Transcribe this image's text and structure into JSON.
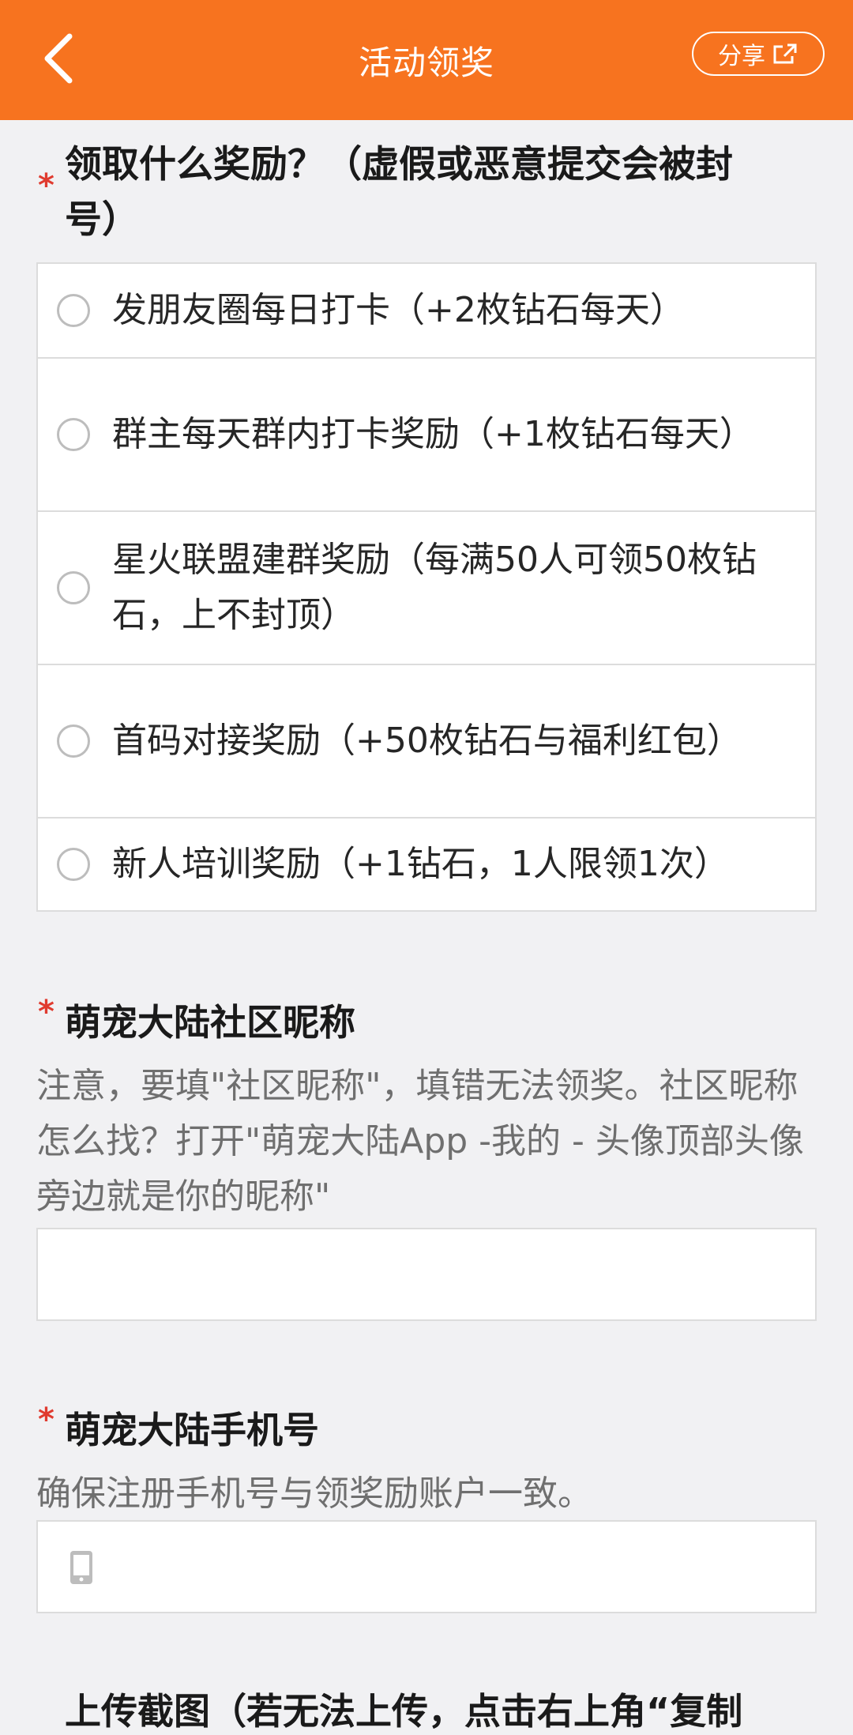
{
  "header": {
    "title": "活动领奖",
    "share_label": "分享",
    "bg_color": "#f7731f",
    "icons": {
      "back": "chevron-left-icon",
      "share": "external-share-icon"
    }
  },
  "question_reward": {
    "required_mark": "*",
    "title": "领取什么奖励？（虚假或恶意提交会被封号）",
    "options": [
      {
        "label": "发朋友圈每日打卡（+2枚钻石每天）"
      },
      {
        "label": "群主每天群内打卡奖励（+1枚钻石每天）"
      },
      {
        "label": "星火联盟建群奖励（每满50人可领50枚钻石，上不封顶）"
      },
      {
        "label": "首码对接奖励（+50枚钻石与福利红包）"
      },
      {
        "label": "新人培训奖励（+1钻石，1人限领1次）"
      }
    ]
  },
  "question_nickname": {
    "required_mark": "*",
    "title": "萌宠大陆社区昵称",
    "description": "注意，要填\"社区昵称\"，填错无法领奖。社区昵称怎么找？打开\"萌宠大陆App -我的 - 头像顶部头像旁边就是你的昵称\"",
    "value": ""
  },
  "question_phone": {
    "required_mark": "*",
    "title": "萌宠大陆手机号",
    "description": "确保注册手机号与领奖励账户一致。",
    "value": "",
    "icon": "phone-icon"
  },
  "next_question_peek": {
    "title": "上传截图（若无法上传，点击右上角“复制"
  }
}
